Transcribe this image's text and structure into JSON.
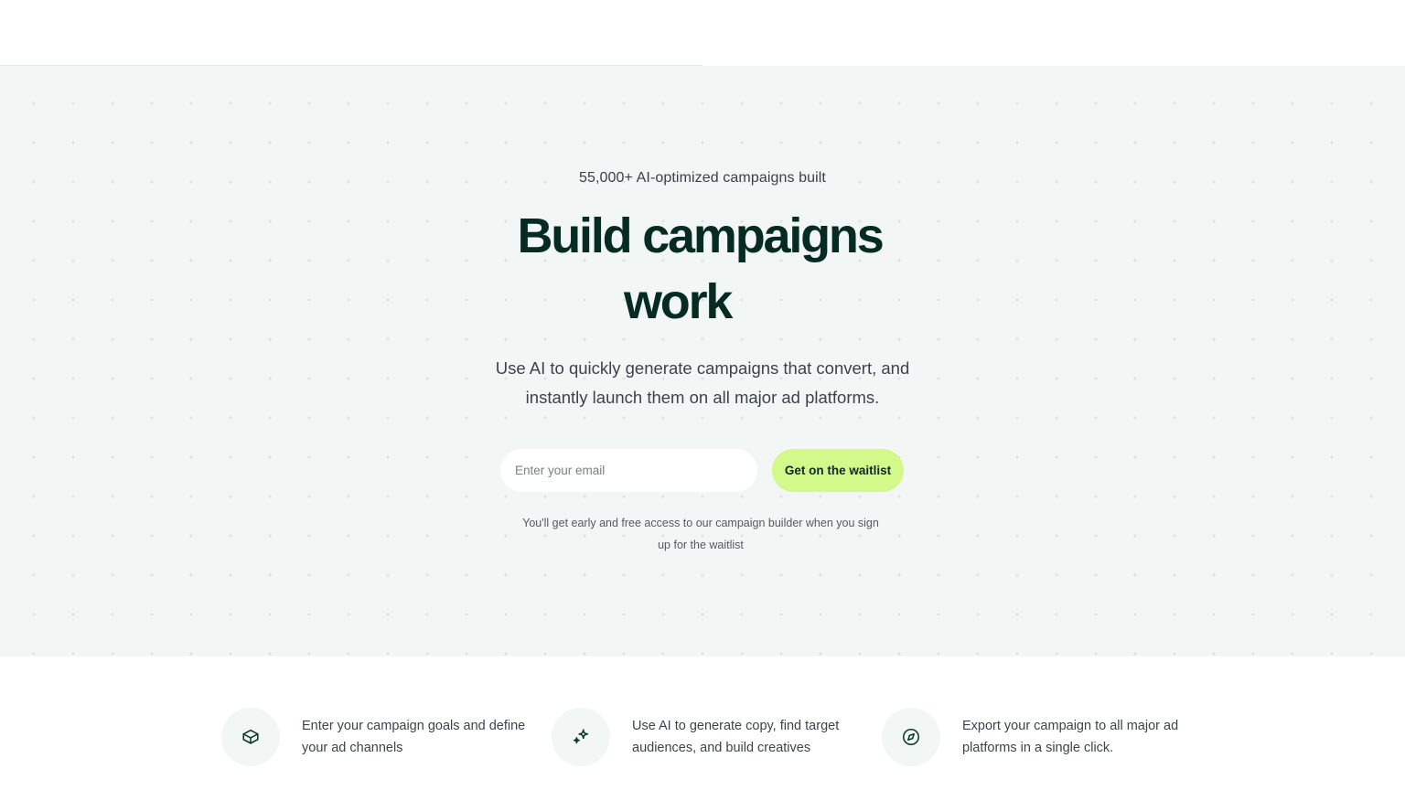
{
  "hero": {
    "eyebrow": "55,000+ AI-optimized campaigns built",
    "headline_line1": "Build campaigns",
    "headline_line2": "work",
    "subtitle": "Use AI to quickly generate campaigns that convert, and instantly launch them on all major ad platforms.",
    "email_placeholder": "Enter your email",
    "email_value": "",
    "cta_label": "Get on the waitlist",
    "note": "You'll get early and free access to our campaign builder when you sign up for the waitlist"
  },
  "features": [
    {
      "icon": "box-icon",
      "text": "Enter your campaign goals and define your ad channels"
    },
    {
      "icon": "sparkles-icon",
      "text": "Use AI to generate copy, find target audiences, and build creatives"
    },
    {
      "icon": "compass-icon",
      "text": "Export your campaign to all major ad platforms in a single click."
    }
  ],
  "colors": {
    "brand_dark": "#062b20",
    "cta_background": "#d3f98b",
    "hero_background": "#f2f6f5"
  }
}
